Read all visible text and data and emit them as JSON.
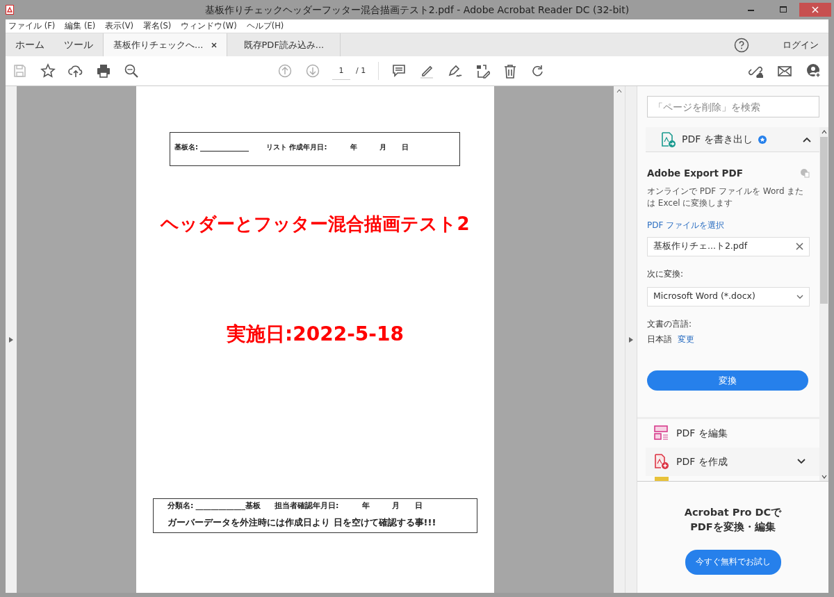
{
  "window": {
    "title": "基板作りチェックヘッダーフッター混合描画テスト2.pdf - Adobe Acrobat Reader DC (32-bit)"
  },
  "menu": [
    "ファイル (F)",
    "編集 (E)",
    "表示(V)",
    "署名(S)",
    "ウィンドウ(W)",
    "ヘルプ(H)"
  ],
  "tabs": [
    {
      "label": "ホーム",
      "kind": "nav",
      "selected": false
    },
    {
      "label": "ツール",
      "kind": "nav",
      "selected": false
    },
    {
      "label": "基板作りチェックへ...",
      "kind": "doc",
      "selected": true,
      "closable": true
    },
    {
      "label": "既存PDF読み込み...",
      "kind": "doc",
      "selected": false,
      "closable": false
    }
  ],
  "login": "ログイン",
  "toolbar": {
    "page": "1",
    "total": "/ 1"
  },
  "document": {
    "header": [
      "基板名:",
      "______________",
      "リスト 作成年月日:",
      "年",
      "月",
      "日"
    ],
    "title": "ヘッダーとフッター混合描画テスト2",
    "date": "実施日:2022-5-18",
    "footer": [
      "分類名:",
      "_____________基板",
      "担当者確認年月日:",
      "年",
      "月",
      "日"
    ],
    "footer_note": "ガーバーデータを外注時には作成日より 日を空けて確認する事!!!"
  },
  "pane": {
    "search": {
      "placeholder": "「ページを削除」を検索"
    },
    "export": {
      "label": "PDF を書き出し",
      "expanded": true,
      "heading": "Adobe Export PDF",
      "description": "オンラインで PDF ファイルを Word または Excel に変換します",
      "select_link": "PDF ファイルを選択",
      "file": "基板作りチェ...ト2.pdf",
      "convert_label": "次に変換:",
      "format": "Microsoft Word (*.docx)",
      "language_label": "文書の言語:",
      "language": "日本語",
      "change_link": "変更",
      "button": "変換"
    },
    "tools": [
      {
        "label": "PDF を編集",
        "kind": "edit",
        "expandable": false
      },
      {
        "label": "PDF を作成",
        "kind": "create",
        "expandable": true
      },
      {
        "kind": "comment",
        "expandable": false
      }
    ],
    "promo": {
      "text": "Acrobat Pro DCで PDFを変換・編集",
      "button": "今すぐ無料でお試し"
    }
  }
}
